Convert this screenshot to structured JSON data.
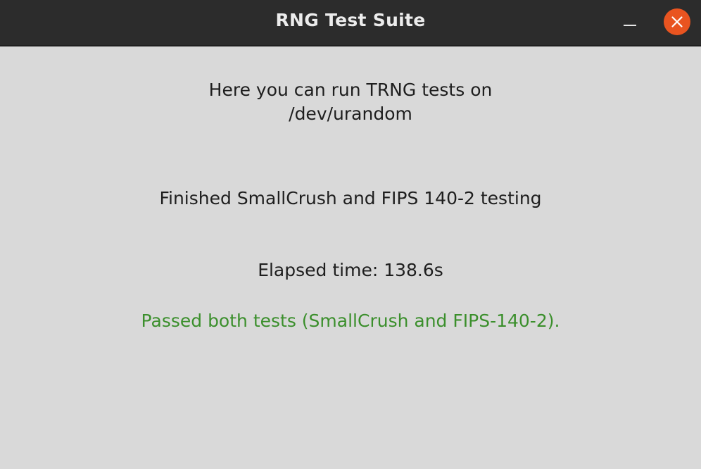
{
  "window": {
    "title": "RNG Test Suite"
  },
  "titlebar": {
    "minimize_icon": "minimize-icon",
    "close_icon": "close-icon",
    "close_color": "#e95420"
  },
  "main": {
    "intro_line1": "Here you can run TRNG tests on",
    "intro_line2": "/dev/urandom",
    "status": "Finished SmallCrush and FIPS 140-2 testing",
    "elapsed": "Elapsed time: 138.6s",
    "result": "Passed both tests (SmallCrush and FIPS-140-2).",
    "result_color": "#3b8f2c"
  }
}
